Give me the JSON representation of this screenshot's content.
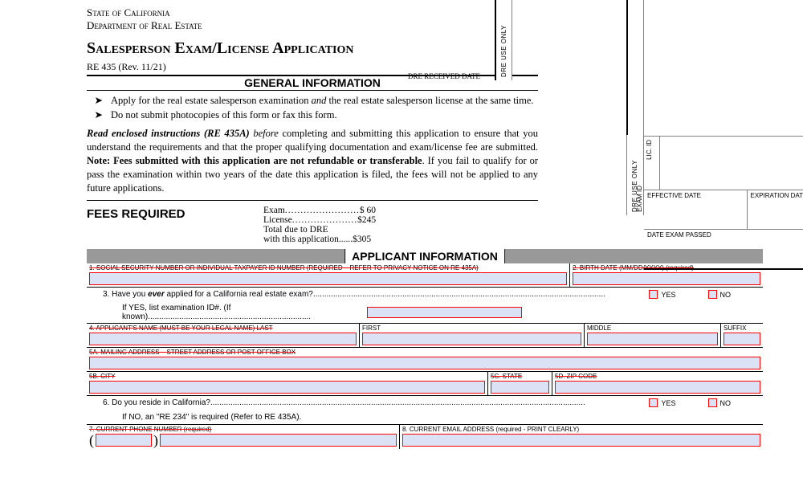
{
  "agency": {
    "state": "State of California",
    "dept": "Department of Real Estate"
  },
  "title": "Salesperson Exam/License Application",
  "formno": "RE 435 (Rev. 11/21)",
  "dre_received": "DRE RECEIVED DATE",
  "stubs": {
    "dre_use_only": "DRE USE ONLY",
    "exam_id": "EXAM ID",
    "lic_id": "LIC. ID"
  },
  "rt": {
    "effective": "EFFECTIVE DATE",
    "expiration": "EXPIRATION DATE",
    "exam_passed": "DATE EXAM PASSED"
  },
  "gi": {
    "header": "GENERAL INFORMATION",
    "b1a": "Apply for the real estate salesperson examination ",
    "b1_and": "and",
    "b1b": " the real estate salesperson license at the same time.",
    "b2": "Do not submit photocopies of this form or fax this form.",
    "p_lead_bold": "Read enclosed instructions (RE 435A)",
    "p_lead_italic": " before",
    "p1": " completing and submitting this application to ensure that you understand the requirements and that the proper qualifying documentation and exam/license fee are submitted. ",
    "p_note_bold": "Note: Fees submitted with this application are not refundable or transferable",
    "p2": ". If you fail to qualify for or pass the examination within two years of the date this application is filed, the fees will not be applied to any future applications."
  },
  "fees": {
    "header": "FEES REQUIRED",
    "exam_label": "Exam",
    "exam_amt": "$  60",
    "license_label": "License",
    "license_amt": "$245",
    "total_l1": "Total due to DRE",
    "total_l2": "with this application",
    "total_amt": "$305"
  },
  "ai_header": "APPLICANT INFORMATION",
  "f": {
    "f1": "1. SOCIAL SECURITY NUMBER OR INDIVIDUAL TAXPAYER ID NUMBER (REQUIRED – REFER TO PRIVACY NOTICE ON RE 435A)",
    "f2": "2. BIRTH DATE (MM/DD/YYYY) (required)",
    "q3": "3. Have you ever applied for a California real estate exam?",
    "q3_italic": "ever",
    "q3_pre": "3. Have you ",
    "q3_post": " applied for a California real estate exam?",
    "q3_sub": "If YES, list examination ID#. (If known)",
    "f4": "4. APPLICANT'S NAME (MUST BE YOUR LEGAL NAME)   LAST",
    "f4_first": "FIRST",
    "f4_middle": "MIDDLE",
    "f4_suffix": "SUFFIX",
    "f5a": "5A. MAILING ADDRESS – STREET ADDRESS OR POST OFFICE BOX",
    "f5b": "5B. CITY",
    "f5c": "5C. STATE",
    "f5d": "5D. ZIP CODE",
    "q6": "6. Do you reside in California?",
    "q6_sub": "If NO, an \"RE 234\" is required (Refer to RE 435A).",
    "f7": "7. CURRENT PHONE NUMBER (required)",
    "f8": "8. CURRENT EMAIL ADDRESS (required - PRINT CLEARLY)",
    "yes": "YES",
    "no": "NO"
  },
  "dots8": "........................",
  "dots7": ".....................",
  "dotsL": "...................................................................................................................................",
  "dotsM": "........................................................................................................................................................................"
}
